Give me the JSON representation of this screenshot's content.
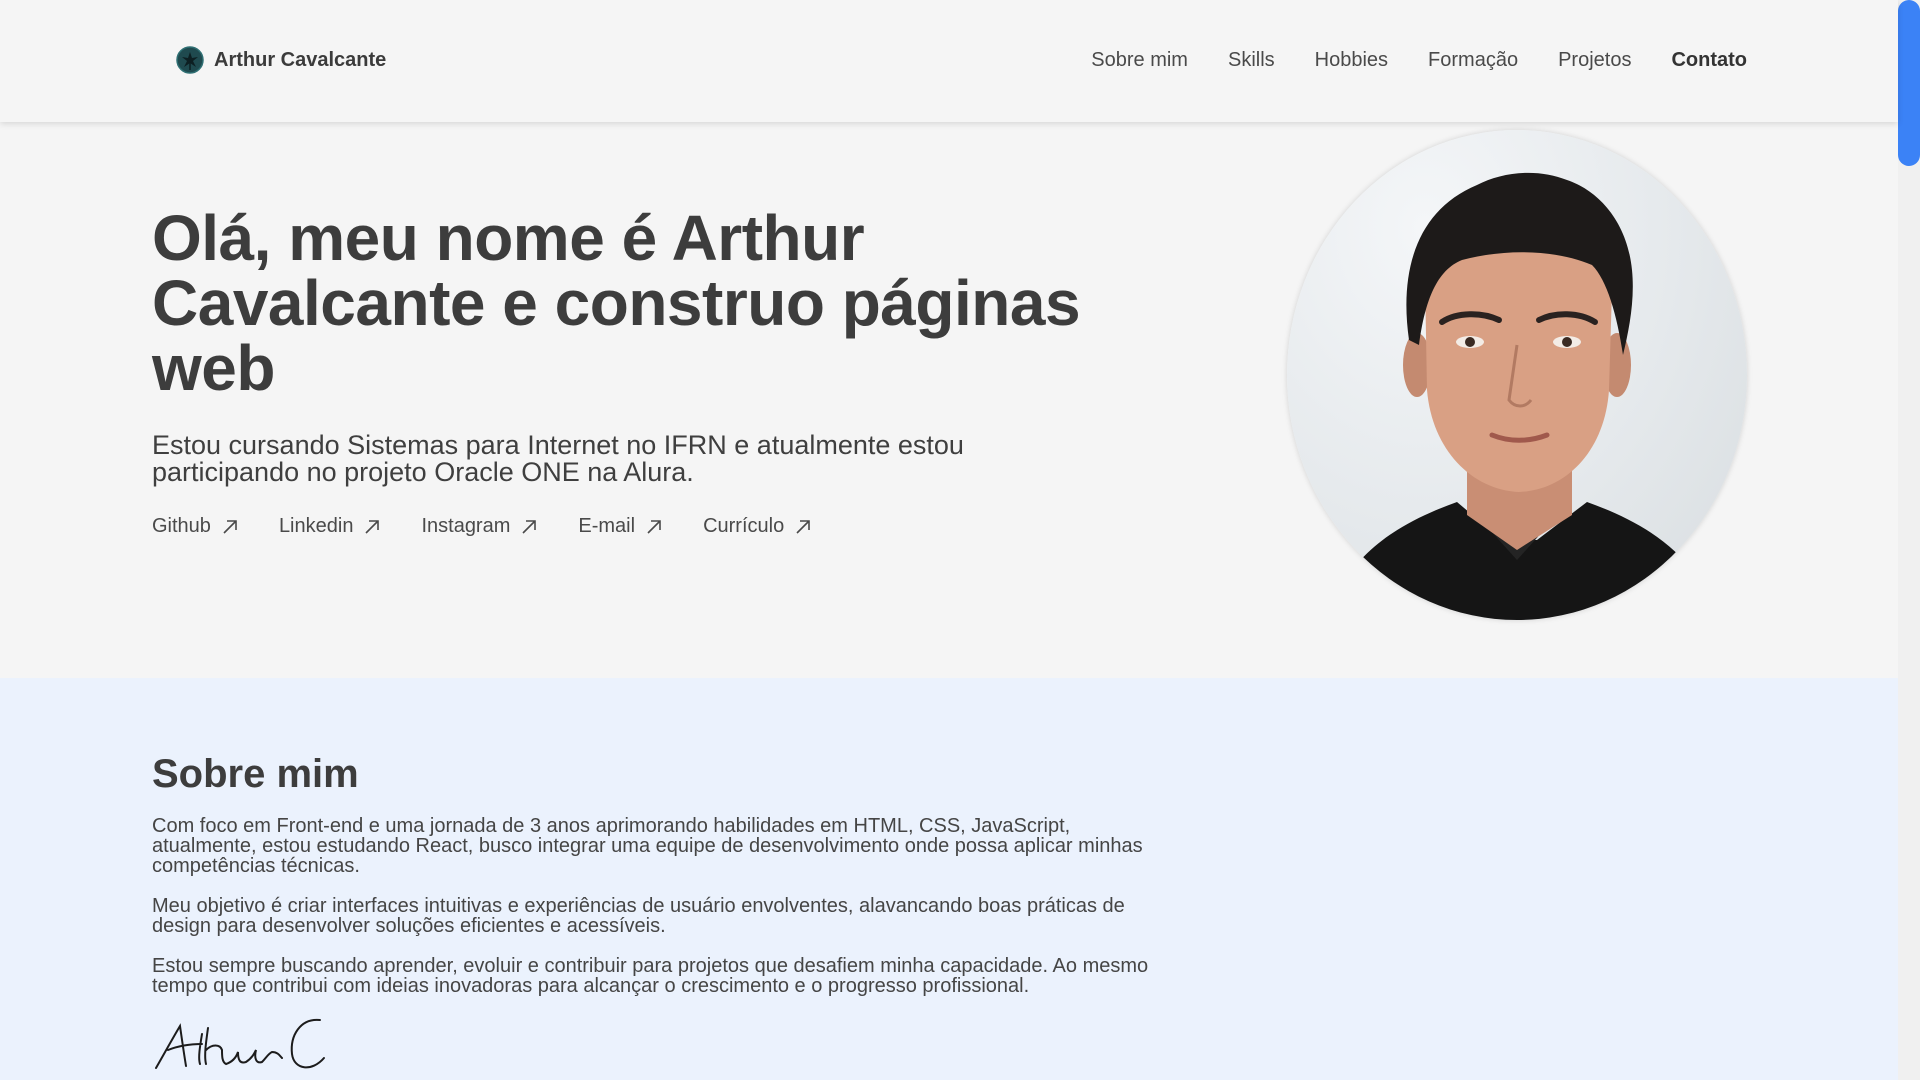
{
  "header": {
    "brand_name": "Arthur Cavalcante",
    "nav": [
      {
        "label": "Sobre mim"
      },
      {
        "label": "Skills"
      },
      {
        "label": "Hobbies"
      },
      {
        "label": "Formação"
      },
      {
        "label": "Projetos"
      },
      {
        "label": "Contato"
      }
    ]
  },
  "hero": {
    "title": "Olá, meu nome é Arthur Cavalcante e construo páginas web",
    "subtitle": "Estou cursando Sistemas para Internet no IFRN e atualmente estou participando no projeto Oracle ONE na Alura.",
    "links": [
      {
        "label": "Github",
        "icon": "arrow-up-right-icon"
      },
      {
        "label": "Linkedin",
        "icon": "arrow-up-right-icon"
      },
      {
        "label": "Instagram",
        "icon": "arrow-up-right-icon"
      },
      {
        "label": "E-mail",
        "icon": "arrow-up-right-icon"
      },
      {
        "label": "Currículo",
        "icon": "arrow-up-right-icon"
      }
    ]
  },
  "about": {
    "title": "Sobre mim",
    "paragraphs": [
      "Com foco em Front-end e uma jornada de 3 anos aprimorando habilidades em HTML, CSS, JavaScript, atualmente, estou estudando React, busco integrar uma equipe de desenvolvimento onde possa aplicar minhas competências técnicas.",
      "Meu objetivo é criar interfaces intuitivas e experiências de usuário envolventes, alavancando boas práticas de design para desenvolver soluções eficientes e acessíveis.",
      "Estou sempre buscando aprender, evoluir e contribuir para projetos que desafiem minha capacidade. Ao mesmo tempo que contribui com ideias inovadoras para alcançar o crescimento e o progresso profissional."
    ],
    "signature": "Arthur C"
  },
  "colors": {
    "accent": "#3b82f6",
    "text": "#3d3d3d",
    "background": "#f5f5f5",
    "about_background": "#ebf2fd"
  }
}
